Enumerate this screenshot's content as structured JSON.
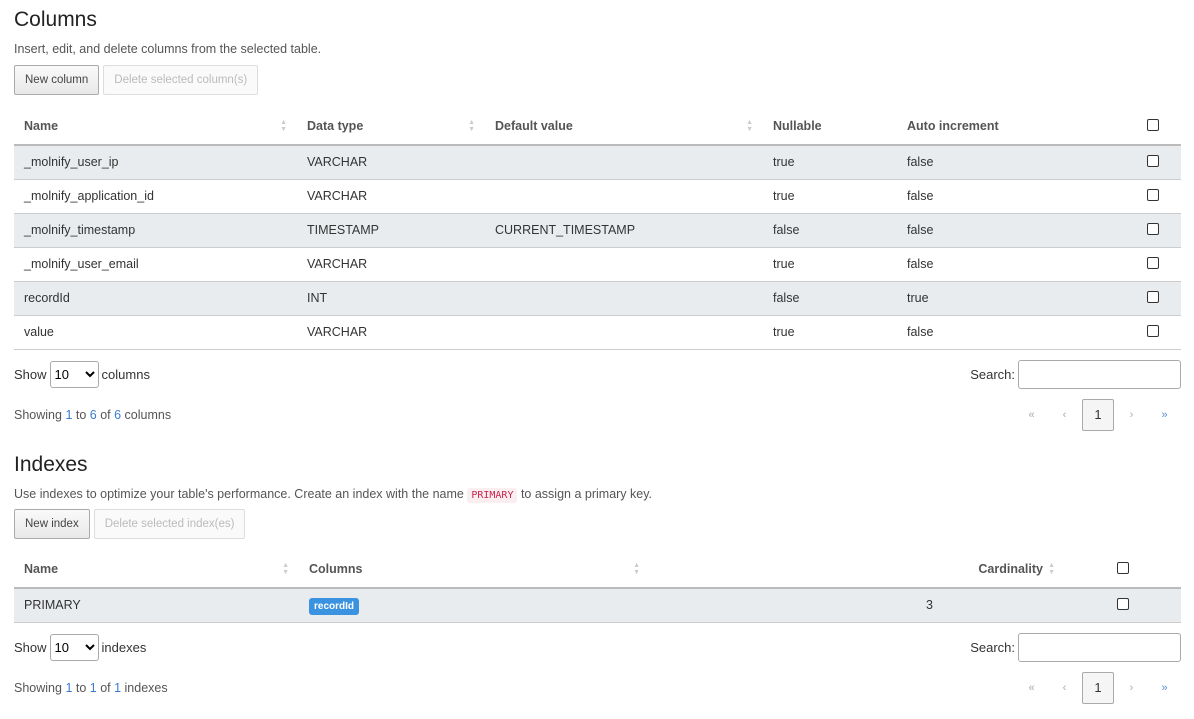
{
  "columns": {
    "title": "Columns",
    "description": "Insert, edit, and delete columns from the selected table.",
    "new_label": "New column",
    "delete_label": "Delete selected column(s)",
    "headers": [
      "Name",
      "Data type",
      "Default value",
      "Nullable",
      "Auto increment"
    ],
    "rows": [
      [
        "_molnify_user_ip",
        "VARCHAR",
        "",
        "true",
        "false"
      ],
      [
        "_molnify_application_id",
        "VARCHAR",
        "",
        "true",
        "false"
      ],
      [
        "_molnify_timestamp",
        "TIMESTAMP",
        "CURRENT_TIMESTAMP",
        "false",
        "false"
      ],
      [
        "_molnify_user_email",
        "VARCHAR",
        "",
        "true",
        "false"
      ],
      [
        "recordId",
        "INT",
        "",
        "false",
        "true"
      ],
      [
        "value",
        "VARCHAR",
        "",
        "true",
        "false"
      ]
    ],
    "show_label": "Show",
    "page_size": "10",
    "unit_label": "columns",
    "search_label": "Search:",
    "search_value": "",
    "info": {
      "a": "Showing ",
      "from": "1",
      "b": " to ",
      "to": "6",
      "c": " of ",
      "total": "6",
      "d": " columns"
    },
    "pagination": {
      "first": "«",
      "prev": "‹",
      "current": "1",
      "next": "›",
      "last": "»"
    }
  },
  "indexes": {
    "title": "Indexes",
    "description_pre": "Use indexes to optimize your table's performance. Create an index with the name ",
    "description_code": "PRIMARY",
    "description_post": " to assign a primary key.",
    "new_label": "New index",
    "delete_label": "Delete selected index(es)",
    "headers": [
      "Name",
      "Columns",
      "Cardinality"
    ],
    "rows": [
      {
        "name": "PRIMARY",
        "columns": [
          "recordId"
        ],
        "cardinality": "3"
      }
    ],
    "show_label": "Show",
    "page_size": "10",
    "unit_label": "indexes",
    "search_label": "Search:",
    "search_value": "",
    "info": {
      "a": "Showing ",
      "from": "1",
      "b": " to ",
      "to": "1",
      "c": " of ",
      "total": "1",
      "d": " indexes"
    },
    "pagination": {
      "first": "«",
      "prev": "‹",
      "current": "1",
      "next": "›",
      "last": "»"
    }
  }
}
